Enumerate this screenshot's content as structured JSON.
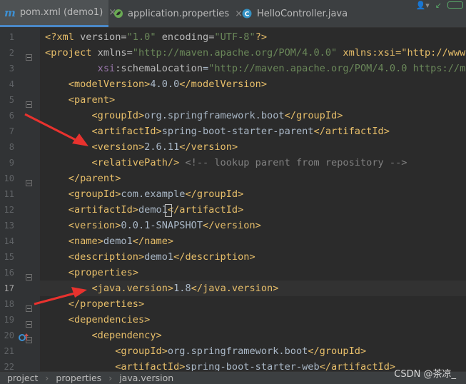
{
  "tabs": [
    {
      "label": "pom.xml (demo1)",
      "icon": "maven-icon",
      "active": true
    },
    {
      "label": "application.properties",
      "icon": "spring-leaf-icon",
      "active": false
    },
    {
      "label": "HelloController.java",
      "icon": "java-class-icon",
      "active": false
    }
  ],
  "tab_close_glyph": "×",
  "code": {
    "lines": [
      {
        "n": "1",
        "text": "<?xml version=\"1.0\" encoding=\"UTF-8\"?>"
      },
      {
        "n": "2",
        "text": "<project xmlns=\"http://maven.apache.org/POM/4.0.0\" xmlns:xsi=\"http://www.w"
      },
      {
        "n": "3",
        "text": "         xsi:schemaLocation=\"http://maven.apache.org/POM/4.0.0 https://mav"
      },
      {
        "n": "4",
        "text": "    <modelVersion>4.0.0</modelVersion>"
      },
      {
        "n": "5",
        "text": "    <parent>"
      },
      {
        "n": "6",
        "text": "        <groupId>org.springframework.boot</groupId>"
      },
      {
        "n": "7",
        "text": "        <artifactId>spring-boot-starter-parent</artifactId>"
      },
      {
        "n": "8",
        "text": "        <version>2.6.11</version>"
      },
      {
        "n": "9",
        "text": "        <relativePath/> <!-- lookup parent from repository -->"
      },
      {
        "n": "10",
        "text": "    </parent>"
      },
      {
        "n": "11",
        "text": "    <groupId>com.example</groupId>"
      },
      {
        "n": "12",
        "text": "    <artifactId>demo1</artifactId>"
      },
      {
        "n": "13",
        "text": "    <version>0.0.1-SNAPSHOT</version>"
      },
      {
        "n": "14",
        "text": "    <name>demo1</name>"
      },
      {
        "n": "15",
        "text": "    <description>demo1</description>"
      },
      {
        "n": "16",
        "text": "    <properties>"
      },
      {
        "n": "17",
        "text": "        <java.version>1.8</java.version>",
        "current": true
      },
      {
        "n": "18",
        "text": "    </properties>"
      },
      {
        "n": "19",
        "text": "    <dependencies>"
      },
      {
        "n": "20",
        "text": "        <dependency>"
      },
      {
        "n": "21",
        "text": "            <groupId>org.springframework.boot</groupId>"
      },
      {
        "n": "22",
        "text": "            <artifactId>spring-boot-starter-web</artifactId>"
      }
    ]
  },
  "breadcrumb": [
    "project",
    "properties",
    "java.version"
  ],
  "watermark": "CSDN @茶凉_",
  "colors": {
    "background": "#2b2b2b",
    "tag": "#e8bf6a",
    "string": "#6a8759",
    "namespace": "#9876aa",
    "comment": "#808080",
    "arrow": "#e8322e"
  }
}
